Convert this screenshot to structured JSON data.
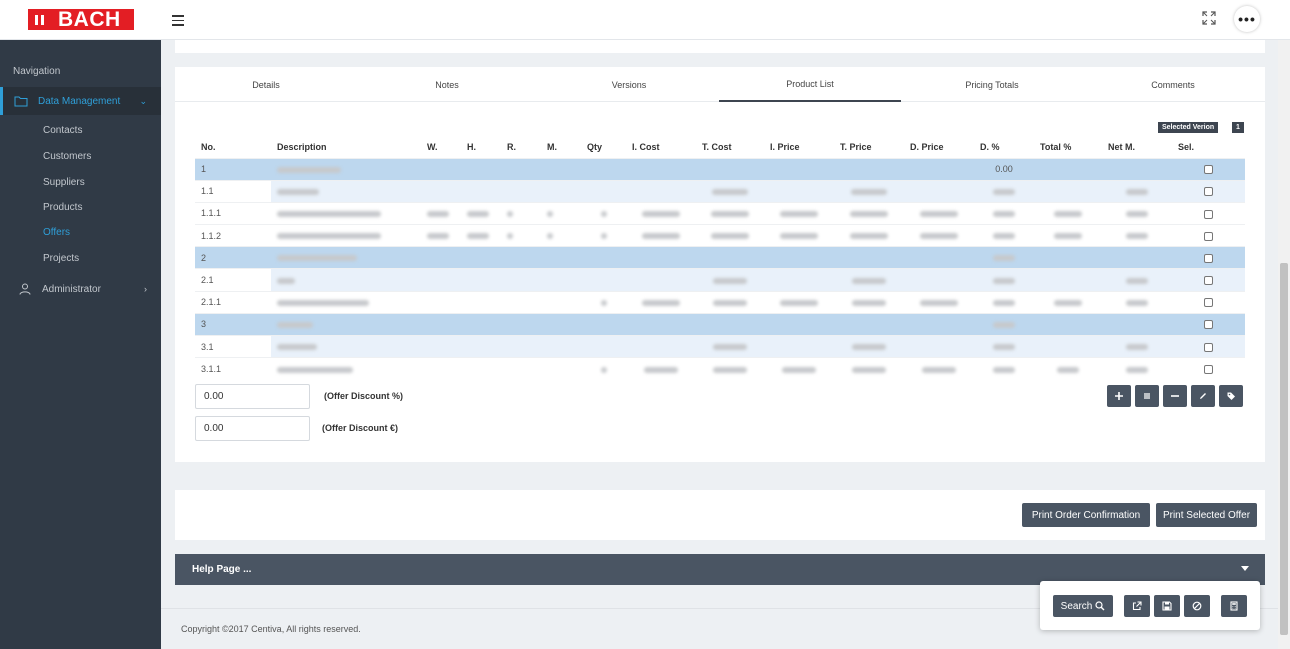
{
  "brand": {
    "logo_text": "BACH",
    "accent": "#e31e24"
  },
  "sidebar": {
    "nav_title": "Navigation",
    "group": {
      "label": "Data Management",
      "icon": "folder-icon"
    },
    "items": [
      {
        "label": "Contacts"
      },
      {
        "label": "Customers"
      },
      {
        "label": "Suppliers"
      },
      {
        "label": "Products"
      },
      {
        "label": "Offers",
        "active": true
      },
      {
        "label": "Projects"
      }
    ],
    "admin": {
      "label": "Administrator",
      "icon": "user-icon"
    }
  },
  "tabs": [
    {
      "label": "Details"
    },
    {
      "label": "Notes"
    },
    {
      "label": "Versions"
    },
    {
      "label": "Product List",
      "active": true
    },
    {
      "label": "Pricing Totals"
    },
    {
      "label": "Comments"
    }
  ],
  "selected_version": {
    "label": "Selected Verion",
    "value": "1"
  },
  "table": {
    "columns": [
      "No.",
      "Description",
      "W.",
      "H.",
      "R.",
      "M.",
      "Qty",
      "I. Cost",
      "T. Cost",
      "I. Price",
      "T. Price",
      "D. Price",
      "D. %",
      "Total %",
      "Net M.",
      "Sel."
    ],
    "rows": [
      {
        "no": "1",
        "dpct": "0.00"
      },
      {
        "no": "1.1"
      },
      {
        "no": "1.1.1"
      },
      {
        "no": "1.1.2"
      },
      {
        "no": "2"
      },
      {
        "no": "2.1"
      },
      {
        "no": "2.1.1"
      },
      {
        "no": "3"
      },
      {
        "no": "3.1"
      },
      {
        "no": "3.1.1"
      }
    ]
  },
  "discount": {
    "percent_value": "0.00",
    "percent_label": "(Offer Discount %)",
    "euro_value": "0.00",
    "euro_label": "(Offer Discount €)"
  },
  "print": {
    "order_confirmation": "Print Order Confirmation",
    "selected_offer": "Print Selected Offer"
  },
  "help": {
    "label": "Help Page ..."
  },
  "footer": {
    "copyright": "Copyright ©2017 Centiva, All rights reserved."
  },
  "toolbar": {
    "search_label": "Search"
  }
}
